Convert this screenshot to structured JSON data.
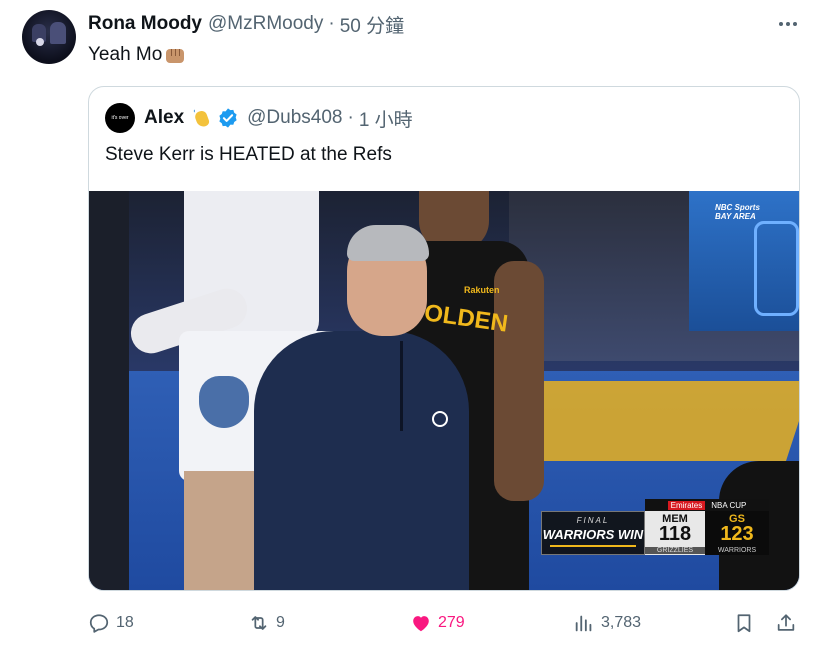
{
  "tweet": {
    "author_name": "Rona Moody",
    "author_handle": "@MzRMoody",
    "separator": "·",
    "time": "50 分鐘",
    "text": "Yeah Mo"
  },
  "quoted": {
    "author_name": "Alex",
    "author_handle": "@Dubs408",
    "separator": "·",
    "time": "1 小時",
    "text": "Steve Kerr is HEATED at the Refs",
    "avatar_text": "it's over"
  },
  "video": {
    "network": "NBC Sports BAY AREA",
    "jersey_text": "OLDEN",
    "jersey_sponsor": "Rakuten",
    "scorebug": {
      "final": "FINAL",
      "result": "WARRIORS WIN",
      "sponsor": "Emirates",
      "cup": "NBA CUP",
      "home_abbr": "MEM",
      "home_score": "118",
      "home_team": "GRIZZLIES",
      "away_abbr": "GS",
      "away_score": "123",
      "away_team": "WARRIORS"
    }
  },
  "actions": {
    "replies": "18",
    "retweets": "9",
    "likes": "279",
    "views": "3,783"
  },
  "colors": {
    "like_active": "#f91880",
    "secondary_text": "#536471",
    "verified": "#1d9bf0",
    "warriors_gold": "#f0b81c"
  }
}
